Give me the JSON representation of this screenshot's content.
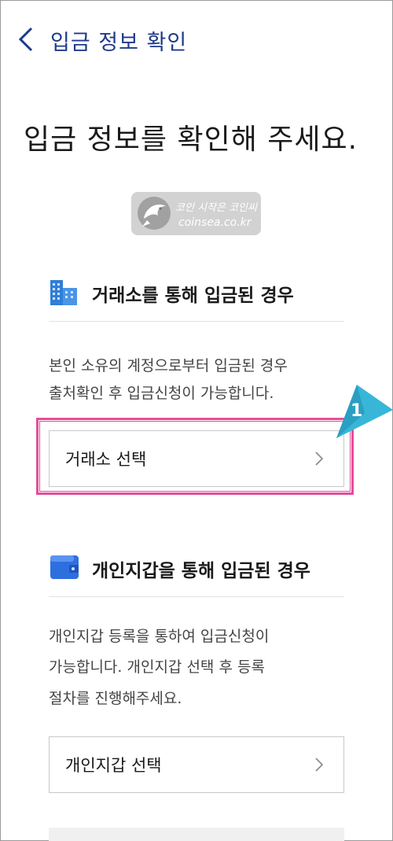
{
  "header": {
    "title": "입금 정보 확인"
  },
  "main": {
    "title": "입금 정보를 확인해 주세요."
  },
  "watermark": {
    "line1": "코인 시작은 코인씨",
    "line2": "coinsea.co.kr"
  },
  "exchange_section": {
    "title": "거래소를 통해 입금된 경우",
    "desc_line1": "본인 소유의 계정으로부터 입금된 경우",
    "desc_line2": "출처확인 후 입금신청이 가능합니다.",
    "select_label": "거래소 선택"
  },
  "wallet_section": {
    "title": "개인지갑을 통해 입금된 경우",
    "desc_line1": "개인지갑 등록을 통하여 입금신청이",
    "desc_line2": "가능합니다. 개인지갑 선택 후 등록",
    "desc_line3": "절차를 진행해주세요.",
    "select_label": "개인지갑 선택"
  },
  "annotation": {
    "step_number": "1",
    "highlight_color": "#e54d9a",
    "callout_color": "#38b6d8"
  },
  "colors": {
    "header_title": "#1f3a8a",
    "building_icon": "#2f7fd8",
    "wallet_icon": "#2e6fe0"
  },
  "icons": {
    "back": "chevron-left-icon",
    "exchange": "building-icon",
    "wallet": "wallet-icon",
    "row_arrow": "chevron-right-icon"
  }
}
